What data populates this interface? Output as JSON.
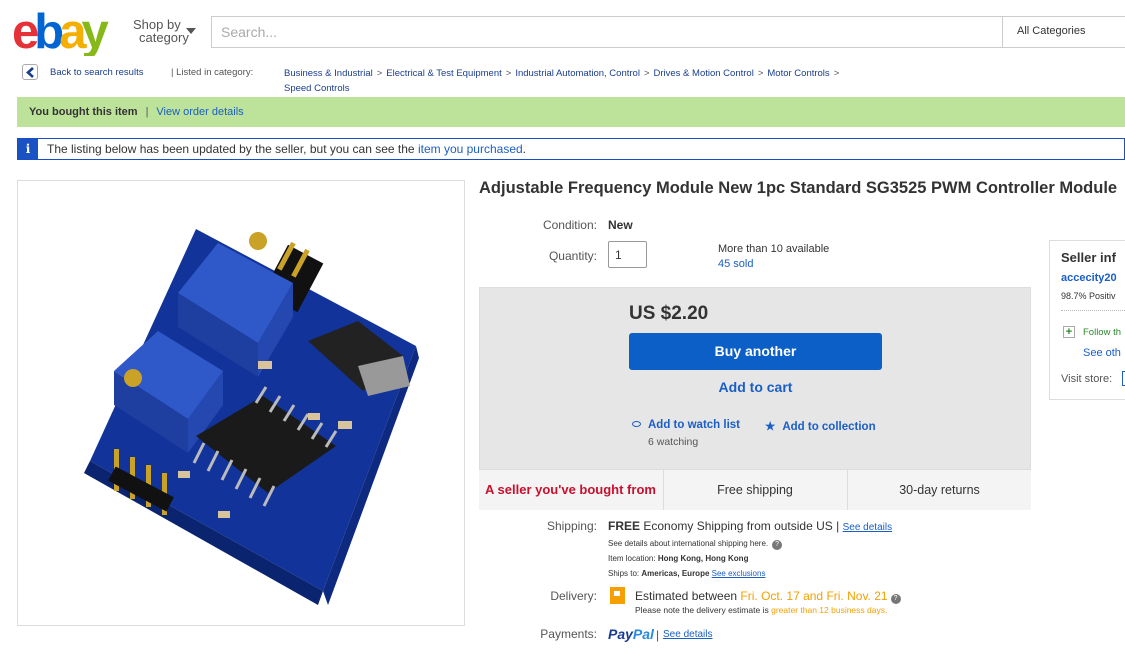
{
  "header": {
    "logo": {
      "letters": [
        "e",
        "b",
        "a",
        "y"
      ],
      "colors": [
        "#e53238",
        "#0064d2",
        "#f5af02",
        "#86b817"
      ]
    },
    "shop_by_line1": "Shop by",
    "shop_by_line2": "category",
    "search_placeholder": "Search...",
    "category_select": "All Categories"
  },
  "breadcrumb": {
    "back_label": "Back to search results",
    "listed_label": "| Listed in category:",
    "items": [
      "Business & Industrial",
      "Electrical & Test Equipment",
      "Industrial Automation, Control",
      "Drives & Motion Control",
      "Motor Controls",
      "Speed Controls"
    ],
    "separator": ">"
  },
  "bought_bar": {
    "text": "You bought this item",
    "divider": "|",
    "link": "View order details"
  },
  "info_bar": {
    "icon": "i",
    "text": "The listing below has been updated by the seller, but you can see the",
    "link": "item you purchased",
    "suffix": "."
  },
  "product": {
    "title": "Adjustable Frequency Module New 1pc Standard SG3525 PWM Controller Module",
    "condition_label": "Condition:",
    "condition_value": "New",
    "quantity_label": "Quantity:",
    "quantity_value": "1",
    "availability": "More than 10 available",
    "sold": "45 sold"
  },
  "purchase": {
    "price": "US $2.20",
    "buy_button": "Buy another",
    "cart_button": "Add to cart",
    "watch_link": "Add to watch list",
    "collection_link": "Add to collection",
    "watching": "6 watching"
  },
  "badges": {
    "seller": "A seller you've bought from",
    "shipping": "Free shipping",
    "returns": "30-day returns"
  },
  "shipping": {
    "label": "Shipping:",
    "free": "FREE",
    "method": "Economy Shipping from outside US",
    "divider": "|",
    "details_link": "See details",
    "note": "See details about international shipping here.",
    "location_label": "Item location:",
    "location_value": "Hong Kong, Hong Kong",
    "ships_to_label": "Ships to:",
    "ships_to_value": "Americas, Europe",
    "exclusions_link": "See exclusions"
  },
  "delivery": {
    "label": "Delivery:",
    "prefix": "Estimated between",
    "dates": "Fri. Oct. 17 and Fri. Nov. 21",
    "note_prefix": "Please note the delivery estimate is",
    "note_highlight": "greater than 12 business days."
  },
  "payments": {
    "label": "Payments:",
    "paypal_1": "Pay",
    "paypal_2": "Pal",
    "divider": "|",
    "details_link": "See details"
  },
  "seller": {
    "title": "Seller inf",
    "name": "accecity20",
    "feedback": "98.7% Positiv",
    "follow": "Follow th",
    "see_other": "See oth",
    "visit_store": "Visit store:"
  },
  "colors": {
    "brand_blue": "#0064d2",
    "buy_button": "#0d5fc8",
    "link_blue": "#1a5ec7",
    "bought_green": "#bde39a",
    "accent_orange": "#f5a000",
    "seller_red": "#c8102e"
  }
}
